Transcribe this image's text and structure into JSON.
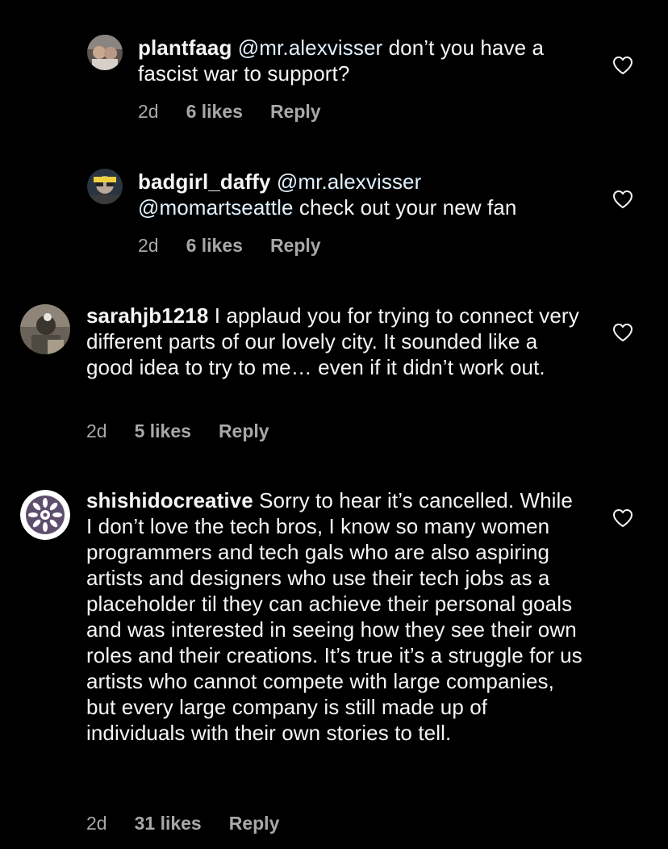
{
  "colors": {
    "background": "#000000",
    "text": "#f5f5f5",
    "mention": "#e0f1ff",
    "meta": "#a8a8a8"
  },
  "comments": [
    {
      "username": "plantfaag",
      "mentions": [
        "@mr.alexvisser"
      ],
      "body": " don’t you have a fascist war to support?",
      "time": "2d",
      "likes": "6 likes",
      "reply": "Reply",
      "avatar_icon": "profile-photo",
      "like_icon": "heart-outline-icon"
    },
    {
      "username": "badgirl_daffy",
      "mentions": [
        "@mr.alexvisser",
        "@momartseattle"
      ],
      "body": " check out your new fan",
      "time": "2d",
      "likes": "6 likes",
      "reply": "Reply",
      "avatar_icon": "profile-photo",
      "like_icon": "heart-outline-icon"
    },
    {
      "username": "sarahjb1218",
      "body": " I applaud you for trying to connect very different parts of our lovely city. It sounded like a good idea to try to me… even if it didn’t work out.",
      "time": "2d",
      "likes": "5 likes",
      "reply": "Reply",
      "avatar_icon": "profile-photo",
      "like_icon": "heart-outline-icon"
    },
    {
      "username": "shishidocreative",
      "body": " Sorry to hear it’s cancelled. While I don’t love the tech bros, I know so many women programmers and tech gals who are also aspiring artists and designers who use their tech jobs as a placeholder til they can achieve their personal goals and was interested in seeing how they see their own roles and their creations. It’s true it’s a struggle for us artists who cannot compete with large companies, but every large company is still made up of individuals with their own stories to tell.",
      "time": "2d",
      "likes": "31 likes",
      "reply": "Reply",
      "avatar_icon": "flower-logo",
      "like_icon": "heart-outline-icon"
    }
  ]
}
